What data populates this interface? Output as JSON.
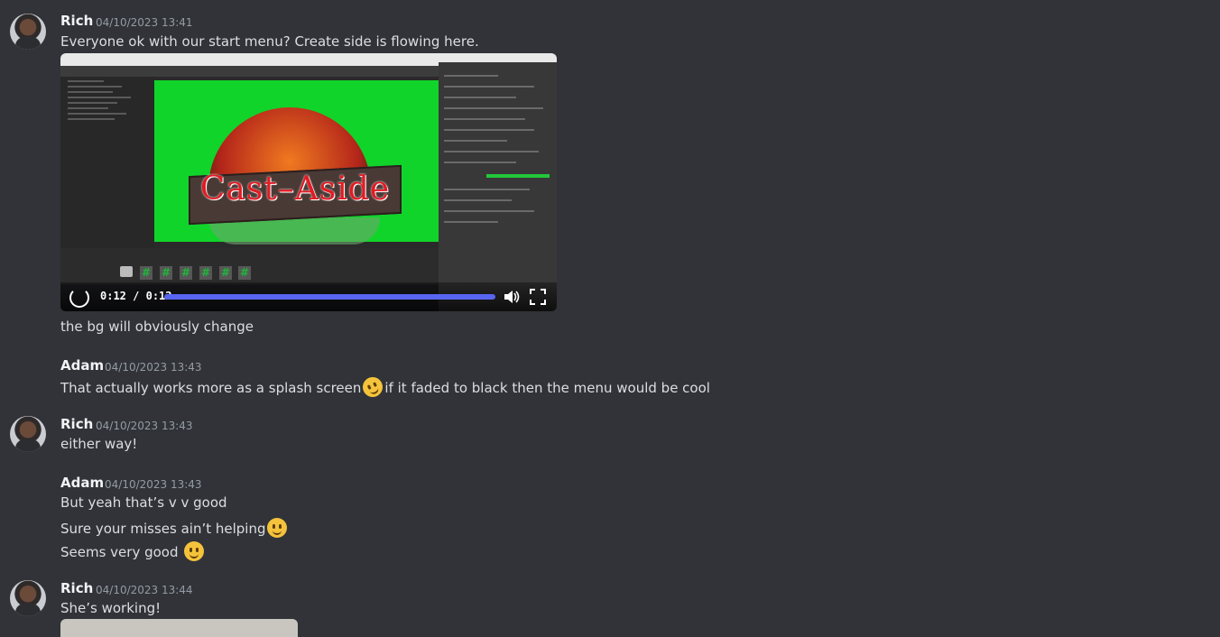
{
  "messages": [
    {
      "author": "Rich",
      "timestamp": "04/10/2023 13:41",
      "lines": [
        "Everyone ok with our start menu? Create side is flowing here.",
        "the bg will obviously change"
      ],
      "video": {
        "banner_text": "Cast–Aside",
        "time": "0:12",
        "duration": "0:12",
        "progress": 1.0,
        "tiles": [
          "#",
          "#",
          "#",
          "#",
          "#",
          "#"
        ]
      }
    },
    {
      "author": "Adam",
      "timestamp": "04/10/2023 13:43",
      "lines": [
        "That actually works more as a splash screen",
        "if it faded to black then the menu would be cool"
      ],
      "emoji": "rolling-on-floor-laughing"
    },
    {
      "author": "Rich",
      "timestamp": "04/10/2023 13:43",
      "lines": [
        "either way!"
      ]
    },
    {
      "author": "Adam",
      "timestamp": "04/10/2023 13:43",
      "lines": [
        "But yeah that’s v v good",
        "Sure your misses ain’t helping",
        "Seems very good"
      ],
      "emojis": [
        "winking-face",
        "slightly-smiling-face"
      ]
    },
    {
      "author": "Rich",
      "timestamp": "04/10/2023 13:44",
      "lines": [
        "She’s working!"
      ]
    }
  ],
  "colors": {
    "background": "#313338",
    "username": "#f2f3f5",
    "timestamp": "#949ba4",
    "text": "#dbdee1",
    "accent": "#5865f2"
  }
}
